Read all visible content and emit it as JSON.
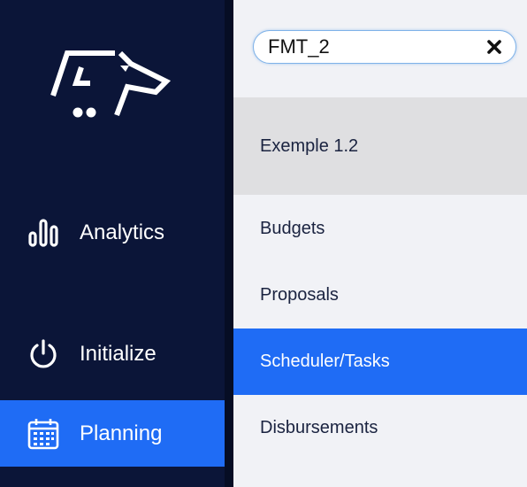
{
  "sidebar": {
    "logo": "dog-head-logo",
    "items": [
      {
        "label": "Analytics",
        "icon": "bar-chart-icon",
        "active": false
      },
      {
        "label": "Initialize",
        "icon": "power-icon",
        "active": false
      },
      {
        "label": "Planning",
        "icon": "calendar-icon",
        "active": true
      }
    ]
  },
  "panel": {
    "search": {
      "value": "FMT_2",
      "clear_icon": "close-icon"
    },
    "group_header": "Exemple 1.2",
    "items": [
      {
        "label": "Budgets",
        "active": false
      },
      {
        "label": "Proposals",
        "active": false
      },
      {
        "label": "Scheduler/Tasks",
        "active": true
      },
      {
        "label": "Disbursements",
        "active": false
      }
    ]
  },
  "colors": {
    "sidebar_bg": "#0b1538",
    "accent": "#1f6cf5",
    "panel_bg": "#f1f2f6",
    "group_header_bg": "#dfdfe1"
  }
}
